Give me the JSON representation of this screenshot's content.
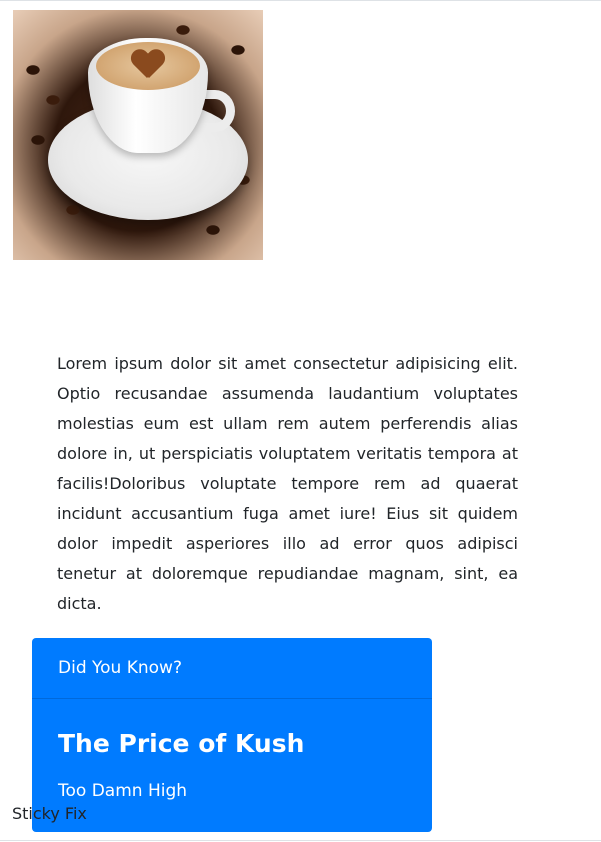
{
  "image": {
    "alt_subject": "coffee-cup-with-beans"
  },
  "article": {
    "body": "Lorem ipsum dolor sit amet consectetur adipisicing elit. Optio recusandae assumenda laudantium voluptates molestias eum est ullam rem autem perferendis alias dolore in, ut perspiciatis voluptatem veritatis tempora at facilis!Doloribus voluptate tempore rem ad quaerat incidunt accusantium fuga amet iure! Eius sit quidem dolor impedit asperiores illo ad error quos adipisci tenetur at doloremque repudiandae magnam, sint, ea dicta."
  },
  "card": {
    "header": "Did You Know?",
    "title": "The Price of Kush",
    "text": "Too Damn High",
    "color": "#007bff"
  },
  "footer": {
    "label": "Sticky Fix"
  }
}
